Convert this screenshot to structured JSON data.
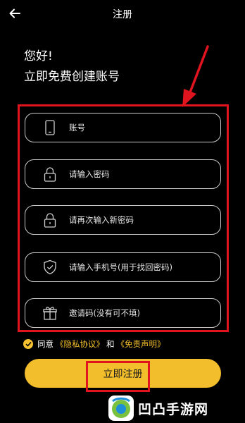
{
  "header": {
    "title": "注册",
    "back_icon": "arrow-left-icon"
  },
  "greeting": {
    "line1": "您好!",
    "line2": "立即免费创建账号"
  },
  "form": {
    "fields": [
      {
        "placeholder": "账号",
        "icon": "phone-icon"
      },
      {
        "placeholder": "请输入密码",
        "icon": "lock-icon"
      },
      {
        "placeholder": "请再次输入新密码",
        "icon": "lock-icon"
      },
      {
        "placeholder": "请输入手机号(用于找回密码)",
        "icon": "shield-check-icon"
      },
      {
        "placeholder": "邀请码(没有可不填)",
        "icon": "gift-icon"
      }
    ]
  },
  "agreement": {
    "prefix": "同意",
    "privacy_link": "《隐私协议》",
    "and": "和",
    "disclaimer_link": "《免责声明》",
    "checked": true
  },
  "register_button": {
    "label": "立即注册"
  },
  "watermark": {
    "text": "凹凸手游网"
  },
  "colors": {
    "background": "#000000",
    "accent": "#f3be2c",
    "annotation_red": "#e0141e"
  }
}
